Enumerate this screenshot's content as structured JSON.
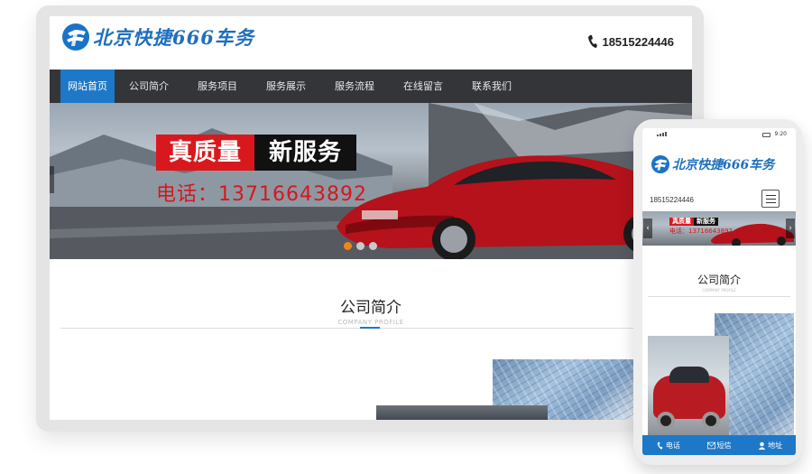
{
  "brand": {
    "name": "北京快捷666车务",
    "logo_icon": "logo-mark-icon",
    "accent": "#1e78c8",
    "nav_bg": "#333538"
  },
  "desktop": {
    "phone": "18515224446",
    "nav": [
      {
        "label": "网站首页",
        "active": true
      },
      {
        "label": "公司简介"
      },
      {
        "label": "服务项目"
      },
      {
        "label": "服务展示"
      },
      {
        "label": "服务流程"
      },
      {
        "label": "在线留言"
      },
      {
        "label": "联系我们"
      }
    ],
    "banner": {
      "slogan_red": "真质量",
      "slogan_black": "新服务",
      "phone": "电话：13716643892",
      "slide_count": 3,
      "active_slide": 1
    },
    "section": {
      "title": "公司简介",
      "subtitle": "COMPANY PROFILE"
    }
  },
  "mobile": {
    "status_time": "9:20",
    "phone": "18515224446",
    "banner": {
      "slogan_red": "真质量",
      "slogan_black": "新服务",
      "phone": "电话：13716643892",
      "prev_icon": "‹",
      "next_icon": "›"
    },
    "section": {
      "title": "公司简介",
      "subtitle": "COMPANY PROFILE"
    },
    "bottom_bar": [
      {
        "label": "电话",
        "icon": "phone-icon"
      },
      {
        "label": "短信",
        "icon": "mail-icon"
      },
      {
        "label": "地址",
        "icon": "user-icon"
      }
    ]
  }
}
